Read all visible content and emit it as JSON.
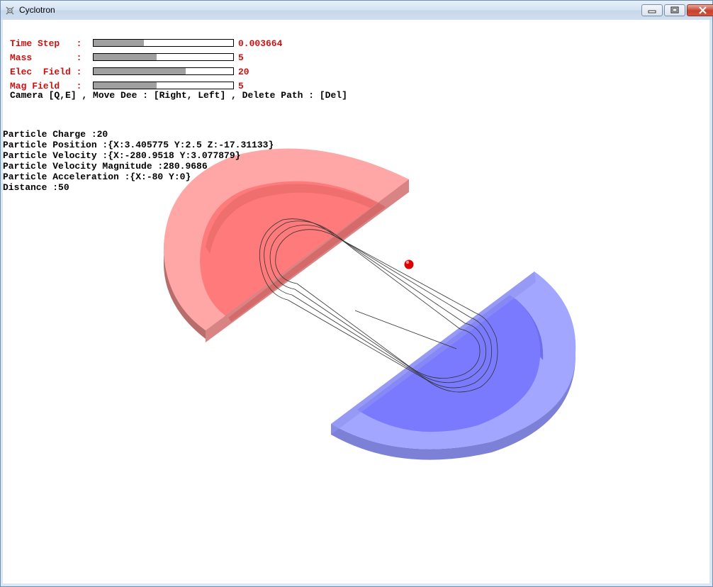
{
  "window": {
    "title": "Cyclotron"
  },
  "controls": [
    {
      "label": "Time Step   :",
      "value": "0.003664",
      "level": 0.36
    },
    {
      "label": "Mass        :",
      "value": "5",
      "level": 0.45
    },
    {
      "label": "Elec  Field :",
      "value": "20",
      "level": 0.66
    },
    {
      "label": "Mag Field   :",
      "value": "5",
      "level": 0.45
    }
  ],
  "help_text": "Camera [Q,E] , Move Dee : [Right, Left] , Delete Path : [Del]",
  "info": [
    "Particle Charge :20",
    "Particle Position :{X:3.405775 Y:2.5 Z:-17.31133}",
    "Particle Velocity :{X:-280.9518 Y:3.077879}",
    "Particle Velocity Magnitude :280.9686",
    "Particle Acceleration :{X:-80 Y:0}",
    "Distance :50"
  ],
  "colors": {
    "dee_red": "#ff7a7a",
    "dee_red_rim": "#ffa6a6",
    "dee_blue": "#7a7aff",
    "dee_blue_rim": "#a2a6ff",
    "label_red": "#cc1111",
    "particle": "#dd0000"
  },
  "icons": {
    "app": "cyclotron-app-icon",
    "minimize": "minimize-icon",
    "maximize": "maximize-icon",
    "close": "close-icon"
  }
}
